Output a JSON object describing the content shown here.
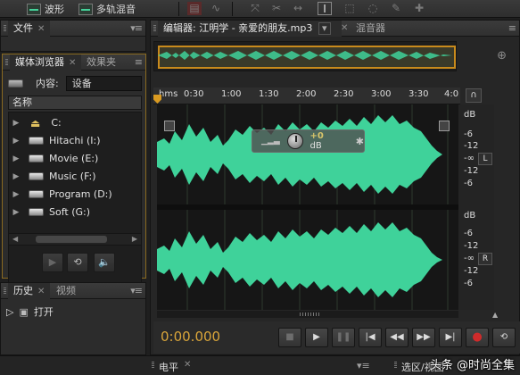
{
  "toolbar": {
    "waveform_label": "波形",
    "multitrack_label": "多轨混音"
  },
  "panels": {
    "files": {
      "tab_label": "文件"
    },
    "media_browser": {
      "tab_label": "媒体浏览器",
      "effects_tab_label": "效果夹",
      "content_label": "内容:",
      "content_value": "设备",
      "column_name": "名称",
      "items": [
        {
          "label": "C:",
          "icon": "drive-c-icon"
        },
        {
          "label": "Hitachi (I:)",
          "icon": "drive-icon"
        },
        {
          "label": "Movie (E:)",
          "icon": "drive-icon"
        },
        {
          "label": "Music (F:)",
          "icon": "drive-icon"
        },
        {
          "label": "Program (D:)",
          "icon": "drive-icon"
        },
        {
          "label": "Soft (G:)",
          "icon": "drive-icon"
        }
      ]
    },
    "history": {
      "tab_label": "历史",
      "video_tab_label": "视频",
      "items": [
        {
          "label": "打开"
        }
      ]
    },
    "editor": {
      "tab_label": "编辑器: 江明学 - 亲爱的朋友.mp3",
      "mixer_tab_label": "混音器",
      "ruler_unit": "hms",
      "ruler_ticks": [
        "0:30",
        "1:00",
        "1:30",
        "2:00",
        "2:30",
        "3:00",
        "3:30",
        "4:0"
      ],
      "db_labels_top": [
        "dB",
        "-6",
        "-12",
        "-∞",
        "-12",
        "-6"
      ],
      "db_labels_bottom": [
        "dB",
        "-6",
        "-12",
        "-∞",
        "-12",
        "-6"
      ],
      "channel_left": "L",
      "channel_right": "R",
      "hud_value": "+0",
      "hud_unit": "dB",
      "timecode": "0:00.000"
    },
    "levels": {
      "tab_label": "电平"
    },
    "selection": {
      "tab_label": "选区/视图"
    }
  },
  "watermark": "头条 @时尚全集",
  "colors": {
    "waveform": "#3fd29a",
    "timecode": "#d9a53a",
    "accent": "#c88a1c",
    "record": "#d02b2b"
  }
}
